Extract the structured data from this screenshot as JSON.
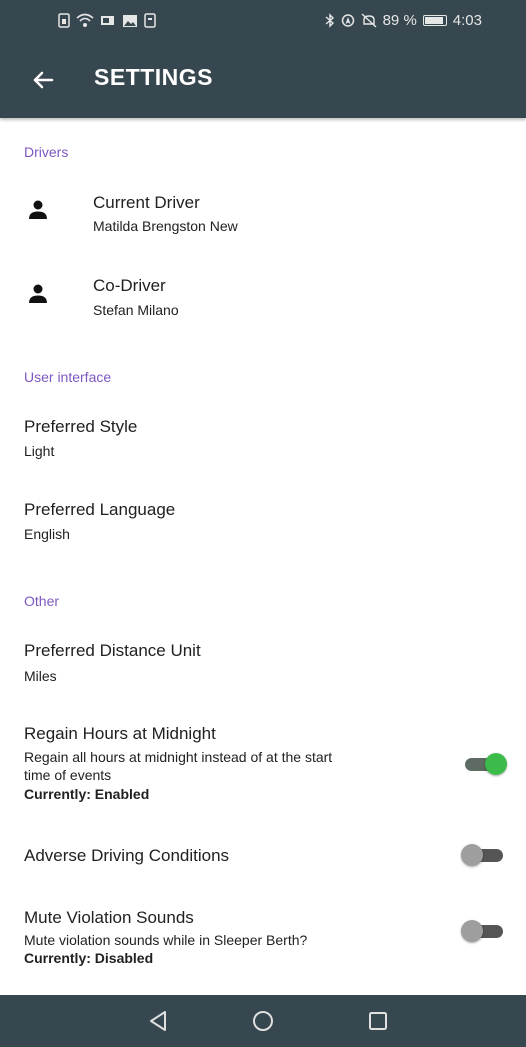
{
  "status_bar": {
    "left_icons": [
      "sim-icon",
      "wifi-icon",
      "cast-icon",
      "image-icon",
      "sd-card-icon"
    ],
    "right_icons": [
      "bluetooth-icon",
      "location-icon",
      "alarm-off-icon"
    ],
    "battery_percent": "89 %",
    "time": "4:03"
  },
  "toolbar": {
    "back_icon": "arrow-back-icon",
    "title": "SETTINGS"
  },
  "sections": {
    "drivers": {
      "header": "Drivers",
      "current_driver": {
        "title": "Current Driver",
        "value": "Matilda Brengston New",
        "icon": "person-icon"
      },
      "co_driver": {
        "title": "Co-Driver",
        "value": "Stefan Milano",
        "icon": "person-icon"
      }
    },
    "user_interface": {
      "header": "User interface",
      "preferred_style": {
        "title": "Preferred Style",
        "value": "Light"
      },
      "preferred_language": {
        "title": "Preferred Language",
        "value": "English"
      }
    },
    "other": {
      "header": "Other",
      "distance_unit": {
        "title": "Preferred Distance Unit",
        "value": "Miles"
      },
      "regain_hours": {
        "title": "Regain Hours at Midnight",
        "summary_line1": "Regain all hours at midnight instead of at the start",
        "summary_line2": "time of events",
        "status": "Currently: Enabled",
        "enabled": true
      },
      "adverse_driving": {
        "title": "Adverse Driving Conditions",
        "enabled": false
      },
      "mute_violation": {
        "title": "Mute Violation Sounds",
        "summary": "Mute violation sounds while in Sleeper Berth?",
        "status": "Currently: Disabled",
        "enabled": false
      }
    }
  },
  "nav_bar": {
    "buttons": [
      "nav-back-icon",
      "nav-home-icon",
      "nav-recents-icon"
    ]
  },
  "colors": {
    "app_bar": "#37474f",
    "section_header": "#7e57c2",
    "toggle_on": "#3cba4a",
    "toggle_off": "#9e9e9e"
  }
}
